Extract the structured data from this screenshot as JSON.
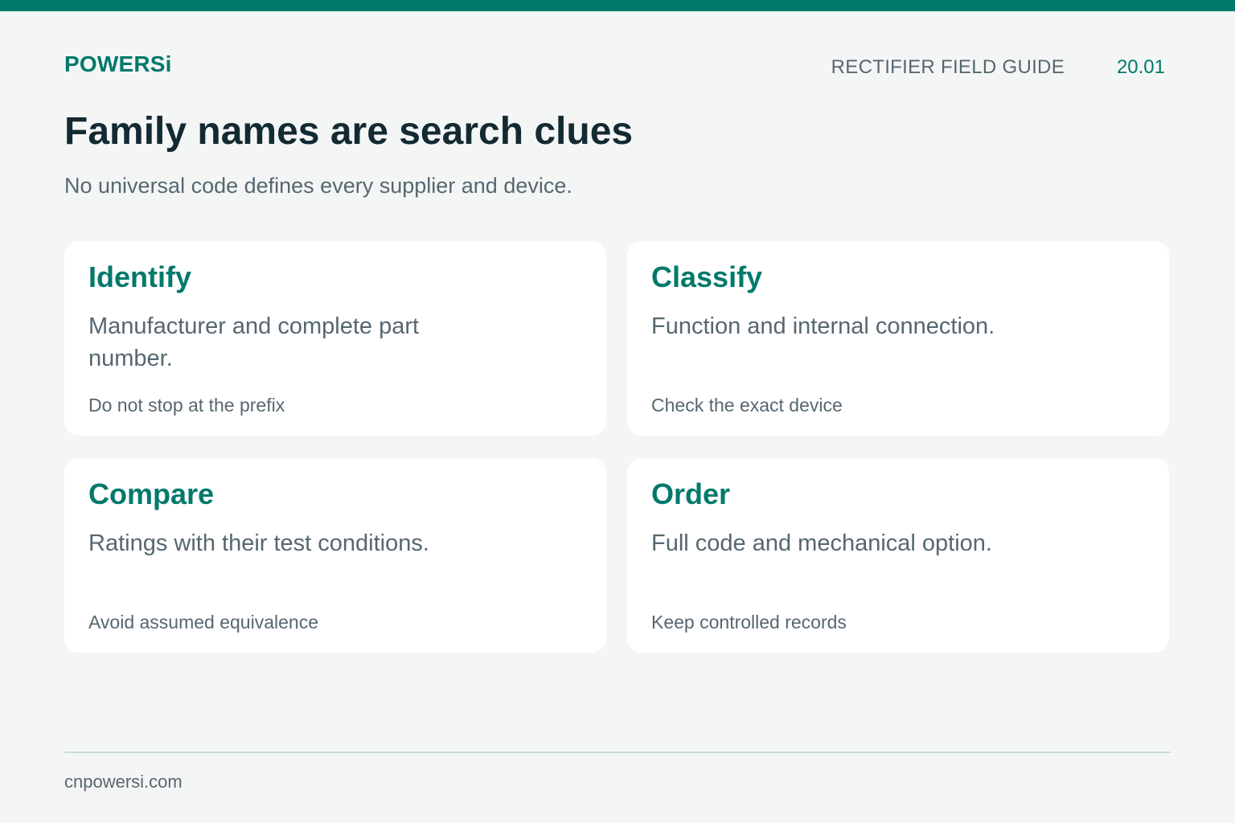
{
  "header": {
    "brand": "POWERSi",
    "guide_title": "RECTIFIER FIELD GUIDE",
    "page_number": "20.01"
  },
  "headline": "Family names are search clues",
  "subtitle": "No universal code defines every supplier and device.",
  "cards": [
    {
      "title": "Identify",
      "body": "Manufacturer and complete part number.",
      "note": "Do not stop at the prefix"
    },
    {
      "title": "Classify",
      "body": "Function and internal connection.",
      "note": "Check the exact device"
    },
    {
      "title": "Compare",
      "body": "Ratings with their test conditions.",
      "note": "Avoid assumed equivalence"
    },
    {
      "title": "Order",
      "body": "Full code and mechanical option.",
      "note": "Keep controlled records"
    }
  ],
  "footer": {
    "url": "cnpowersi.com"
  },
  "colors": {
    "accent": "#00796b",
    "heading": "#142a33",
    "text": "#566770",
    "background": "#f4f6f5",
    "card": "#ffffff",
    "divider": "#c9dcd6"
  }
}
